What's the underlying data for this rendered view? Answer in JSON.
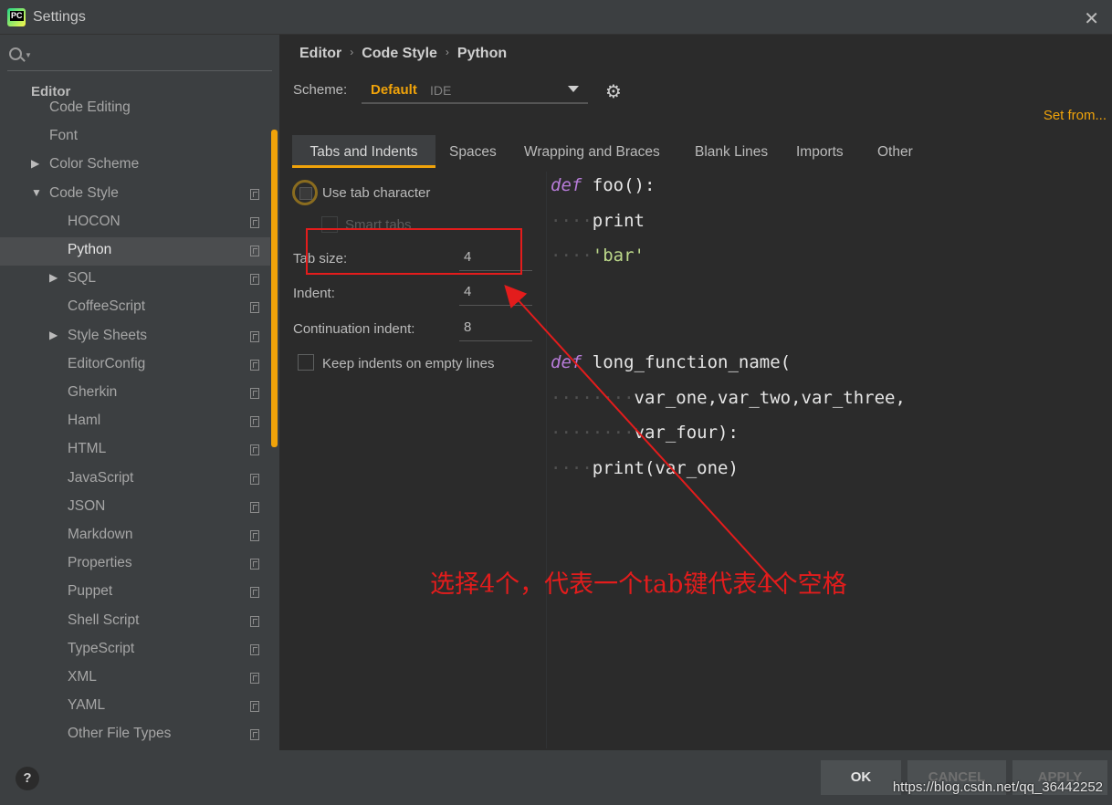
{
  "window": {
    "title": "Settings",
    "close_glyph": "✕"
  },
  "sidebar": {
    "search_placeholder": "",
    "section": "Editor",
    "items": [
      {
        "label": "Code Editing",
        "level": 1,
        "arrow": "",
        "copy": false,
        "selected": false
      },
      {
        "label": "Font",
        "level": 1,
        "arrow": "",
        "copy": false,
        "selected": false
      },
      {
        "label": "Color Scheme",
        "level": 1,
        "arrow": "▶",
        "copy": false,
        "selected": false
      },
      {
        "label": "Code Style",
        "level": 1,
        "arrow": "▼",
        "copy": true,
        "selected": false
      },
      {
        "label": "HOCON",
        "level": 2,
        "arrow": "",
        "copy": true,
        "selected": false
      },
      {
        "label": "Python",
        "level": 2,
        "arrow": "",
        "copy": true,
        "selected": true
      },
      {
        "label": "SQL",
        "level": 2,
        "arrow": "▶",
        "copy": true,
        "selected": false
      },
      {
        "label": "CoffeeScript",
        "level": 2,
        "arrow": "",
        "copy": true,
        "selected": false
      },
      {
        "label": "Style Sheets",
        "level": 2,
        "arrow": "▶",
        "copy": true,
        "selected": false
      },
      {
        "label": "EditorConfig",
        "level": 2,
        "arrow": "",
        "copy": true,
        "selected": false
      },
      {
        "label": "Gherkin",
        "level": 2,
        "arrow": "",
        "copy": true,
        "selected": false
      },
      {
        "label": "Haml",
        "level": 2,
        "arrow": "",
        "copy": true,
        "selected": false
      },
      {
        "label": "HTML",
        "level": 2,
        "arrow": "",
        "copy": true,
        "selected": false
      },
      {
        "label": "JavaScript",
        "level": 2,
        "arrow": "",
        "copy": true,
        "selected": false
      },
      {
        "label": "JSON",
        "level": 2,
        "arrow": "",
        "copy": true,
        "selected": false
      },
      {
        "label": "Markdown",
        "level": 2,
        "arrow": "",
        "copy": true,
        "selected": false
      },
      {
        "label": "Properties",
        "level": 2,
        "arrow": "",
        "copy": true,
        "selected": false
      },
      {
        "label": "Puppet",
        "level": 2,
        "arrow": "",
        "copy": true,
        "selected": false
      },
      {
        "label": "Shell Script",
        "level": 2,
        "arrow": "",
        "copy": true,
        "selected": false
      },
      {
        "label": "TypeScript",
        "level": 2,
        "arrow": "",
        "copy": true,
        "selected": false
      },
      {
        "label": "XML",
        "level": 2,
        "arrow": "",
        "copy": true,
        "selected": false
      },
      {
        "label": "YAML",
        "level": 2,
        "arrow": "",
        "copy": true,
        "selected": false
      },
      {
        "label": "Other File Types",
        "level": 2,
        "arrow": "",
        "copy": true,
        "selected": false
      }
    ]
  },
  "breadcrumb": [
    "Editor",
    "Code Style",
    "Python"
  ],
  "breadcrumb_sep": "›",
  "scheme": {
    "label": "Scheme:",
    "name": "Default",
    "sub": "IDE",
    "set_from": "Set from..."
  },
  "tabs": [
    "Tabs and Indents",
    "Spaces",
    "Wrapping and Braces",
    "Blank Lines",
    "Imports",
    "Other"
  ],
  "options": {
    "use_tab_character": "Use tab character",
    "smart_tabs": "Smart tabs",
    "tab_size_label": "Tab size:",
    "tab_size": "4",
    "indent_label": "Indent:",
    "indent": "4",
    "continuation_label": "Continuation indent:",
    "continuation": "8",
    "keep_indents": "Keep indents on empty lines"
  },
  "code": {
    "line1_kw": "def",
    "line1_rest": " foo():",
    "line2_dots": "····",
    "line2": "print",
    "line3_dots": "····",
    "line3": "'bar'",
    "line4_kw": "def",
    "line4_rest": " long_function_name(",
    "line5_dots": "········",
    "line5": "var_one,var_two,var_three,",
    "line6_dots": "········",
    "line6": "var_four):",
    "line7_dots": "····",
    "line7": "print(var_one)"
  },
  "annotation": "选择4个，代表一个tab键代表4个空格",
  "footer": {
    "help": "?",
    "ok": "OK",
    "cancel": "CANCEL",
    "apply": "APPLY",
    "watermark": "https://blog.csdn.net/qq_36442252"
  },
  "colors": {
    "accent": "#f0a30a",
    "annotation": "#e31c1c"
  }
}
